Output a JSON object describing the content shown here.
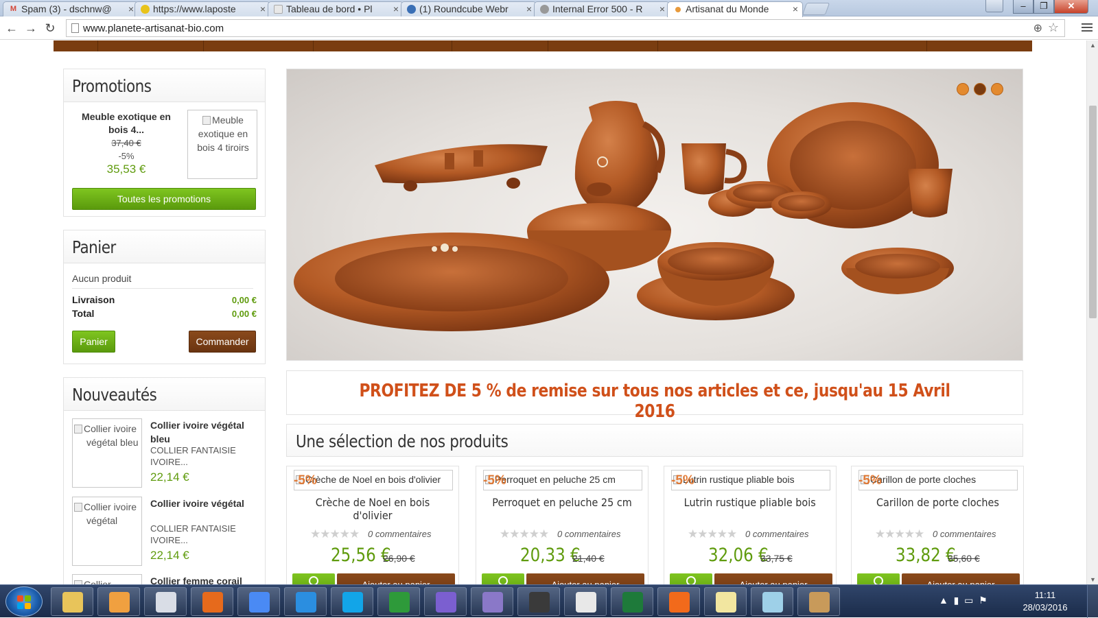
{
  "browser": {
    "tabs": [
      {
        "label": "Spam (3) - dschnw@",
        "icon_text": "M",
        "icon_color": "#d44638"
      },
      {
        "label": "https://www.laposte",
        "icon_text": "",
        "icon_color": "#e8c31b"
      },
      {
        "label": "Tableau de bord • Pl",
        "icon_text": "",
        "icon_color": "#cfcfcf"
      },
      {
        "label": "(1) Roundcube Webr",
        "icon_text": "",
        "icon_color": "#3a6fb5"
      },
      {
        "label": "Internal Error 500 - R",
        "icon_text": "",
        "icon_color": "#999999"
      },
      {
        "label": "Artisanat du Monde",
        "icon_text": "",
        "icon_color": "#e89a3c"
      }
    ],
    "close_glyph": "×",
    "url": "www.planete-artisanat-bio.com",
    "win_min": "–",
    "win_max": "❐",
    "win_close": "✕"
  },
  "sidebar": {
    "promotions": {
      "title": "Promotions",
      "product_name": "Meuble exotique en bois 4...",
      "old_price": "37,40 €",
      "discount": "-5%",
      "price": "35,53 €",
      "image_alt": "Meuble exotique en bois 4 tiroirs",
      "button": "Toutes les promotions"
    },
    "cart": {
      "title": "Panier",
      "empty": "Aucun produit",
      "shipping_label": "Livraison",
      "shipping_value": "0,00 €",
      "total_label": "Total",
      "total_value": "0,00 €",
      "cart_button": "Panier",
      "order_button": "Commander"
    },
    "news": {
      "title": "Nouveautés",
      "items": [
        {
          "image_alt": "Collier ivoire végétal bleu",
          "name": "Collier ivoire végétal bleu",
          "desc": "COLLIER FANTAISIE IVOIRE...",
          "price": "22,14 €"
        },
        {
          "image_alt": "Collier ivoire végétal",
          "name": "Collier ivoire végétal",
          "desc": "COLLIER FANTAISIE IVOIRE...",
          "price": "22,14 €"
        },
        {
          "image_alt": "Collier",
          "name": "Collier femme corail",
          "desc": "",
          "price": ""
        }
      ]
    }
  },
  "slider": {
    "dots": 3,
    "active_dot": 1
  },
  "banner": "PROFITEZ DE 5 % de remise sur tous nos articles et ce, jusqu'au 15 Avril 2016",
  "selection_title": "Une sélection de nos produits",
  "products": [
    {
      "image_alt": "Crèche de Noel en bois d'olivier",
      "badge": "-5%",
      "name": "Crèche de Noel en bois d'olivier",
      "stars": "★★★★★",
      "comments": "0 commentaires",
      "price": "25,56 €",
      "old_price": "26,90 €",
      "add_label": "Ajouter au panier"
    },
    {
      "image_alt": "Perroquet en peluche 25 cm",
      "badge": "-5%",
      "name": "Perroquet en peluche 25 cm",
      "stars": "★★★★★",
      "comments": "0 commentaires",
      "price": "20,33 €",
      "old_price": "21,40 €",
      "add_label": "Ajouter au panier"
    },
    {
      "image_alt": "Lutrin rustique pliable bois",
      "badge": "-5%",
      "name": "Lutrin rustique pliable bois",
      "stars": "★★★★★",
      "comments": "0 commentaires",
      "price": "32,06 €",
      "old_price": "33,75 €",
      "add_label": "Ajouter au panier"
    },
    {
      "image_alt": "Carillon de porte cloches",
      "badge": "-5%",
      "name": "Carillon de porte cloches",
      "stars": "★★★★★",
      "comments": "0 commentaires",
      "price": "33,82 €",
      "old_price": "35,60 €",
      "add_label": "Ajouter au panier"
    }
  ],
  "taskbar": {
    "apps": [
      {
        "name": "explorer-icon",
        "color": "#e8c45a"
      },
      {
        "name": "media-player-icon",
        "color": "#f0a040"
      },
      {
        "name": "paint-tool-icon",
        "color": "#d9dde6"
      },
      {
        "name": "firefox-icon",
        "color": "#e66a1c"
      },
      {
        "name": "chrome-icon",
        "color": "#4a8af4"
      },
      {
        "name": "internet-explorer-icon",
        "color": "#2b8ee0"
      },
      {
        "name": "skype-icon",
        "color": "#12a5e8"
      },
      {
        "name": "chart-app-icon",
        "color": "#2e9a3a"
      },
      {
        "name": "dots-app-icon",
        "color": "#7b5fd0"
      },
      {
        "name": "pencil-app-icon",
        "color": "#8a78c8"
      },
      {
        "name": "grid-app-icon",
        "color": "#3a3a3a"
      },
      {
        "name": "cards-game-icon",
        "color": "#e8e8e8"
      },
      {
        "name": "excel-icon",
        "color": "#1e7a3a"
      },
      {
        "name": "xampp-icon",
        "color": "#f26a1b"
      },
      {
        "name": "notepad-icon",
        "color": "#f2e6a0"
      },
      {
        "name": "sketch-app-icon",
        "color": "#9ed0e8"
      },
      {
        "name": "paint-palette-icon",
        "color": "#c89a5a"
      }
    ],
    "time": "11:11",
    "date": "28/03/2016"
  }
}
